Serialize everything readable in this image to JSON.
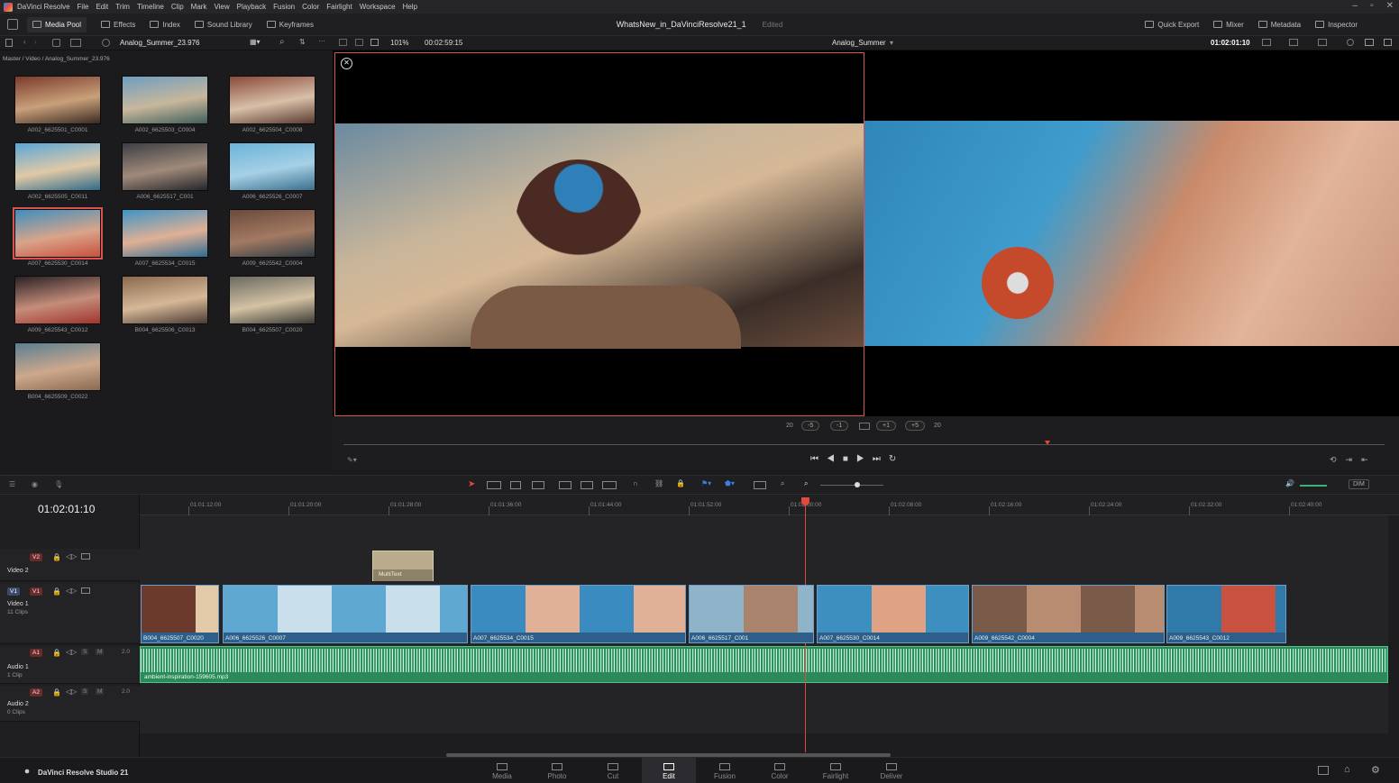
{
  "app": {
    "name": "DaVinci Resolve",
    "studio_label": "DaVinci Resolve Studio 21"
  },
  "menu": [
    "File",
    "Edit",
    "Trim",
    "Timeline",
    "Clip",
    "Mark",
    "View",
    "Playback",
    "Fusion",
    "Color",
    "Fairlight",
    "Workspace",
    "Help"
  ],
  "toolbar": {
    "left": [
      "Media Pool",
      "Effects",
      "Index",
      "Sound Library",
      "Keyframes"
    ],
    "project_title": "WhatsNew_in_DaVinciResolve21_1",
    "edited": "Edited",
    "right": [
      "Quick Export",
      "Mixer",
      "Metadata",
      "Inspector"
    ]
  },
  "subbar": {
    "bin": "Analog_Summer_23.976",
    "zoom": "101%",
    "duration": "00:02:59:15",
    "timeline_name": "Analog_Summer",
    "timecode": "01:02:01:10"
  },
  "mediapool": {
    "path": "Master / Video / Analog_Summer_23.976",
    "clips": [
      {
        "name": "A002_6625501_C0001",
        "colors": [
          "#7a3b2c",
          "#c9a07a",
          "#3a2a22"
        ]
      },
      {
        "name": "A002_6625503_C0004",
        "colors": [
          "#6f9ec0",
          "#c8b79c",
          "#3f5f5a"
        ]
      },
      {
        "name": "A002_6625504_C0008",
        "colors": [
          "#8a4a3a",
          "#d8c0a8",
          "#5a3a30"
        ]
      },
      {
        "name": "A002_6625505_C0011",
        "colors": [
          "#5aa7d8",
          "#e0c9a6",
          "#2f6a8a"
        ]
      },
      {
        "name": "A006_6625517_C001",
        "colors": [
          "#3c3f46",
          "#a08a7a",
          "#24262a"
        ]
      },
      {
        "name": "A006_6625526_C0007",
        "colors": [
          "#6bb3d8",
          "#a6d0e6",
          "#3b6f8c"
        ]
      },
      {
        "name": "A007_6625530_C0014",
        "colors": [
          "#3d8fc0",
          "#d9a48a",
          "#c9503c"
        ]
      },
      {
        "name": "A007_6625534_C0015",
        "colors": [
          "#3e94c6",
          "#e0b095",
          "#2f6c92"
        ]
      },
      {
        "name": "A009_6625542_C0004",
        "colors": [
          "#6a4a3c",
          "#a37a62",
          "#2e3b44"
        ]
      },
      {
        "name": "A009_6625543_C0012",
        "colors": [
          "#2a2224",
          "#c58d7a",
          "#a0342c"
        ]
      },
      {
        "name": "B004_6625506_C0013",
        "colors": [
          "#8a6a4e",
          "#d6b898",
          "#4a3a32"
        ]
      },
      {
        "name": "B004_6625507_C0020",
        "colors": [
          "#6b6a62",
          "#d4c2a4",
          "#3a3a34"
        ]
      },
      {
        "name": "B004_6625509_C0022",
        "colors": [
          "#5a7f92",
          "#cda88c",
          "#8a6a52"
        ]
      }
    ]
  },
  "viewer": {
    "transport_offsets": [
      "20",
      "-5",
      "-1",
      "+1",
      "+5",
      "20"
    ]
  },
  "timeline": {
    "timecode": "01:02:01:10",
    "ruler": [
      "01:01:12:00",
      "01:01:20:00",
      "01:01:28:00",
      "01:01:36:00",
      "01:01:44:00",
      "01:01:52:00",
      "01:02:00:00",
      "01:02:08:00",
      "01:02:16:00",
      "01:02:24:00",
      "01:02:32:00",
      "01:02:40:00"
    ],
    "tracks": {
      "v2": {
        "badge": "V2",
        "name": "Video 2"
      },
      "v1": {
        "badge_a": "V1",
        "badge": "V1",
        "name": "Video 1",
        "count": "11 Clips"
      },
      "a1": {
        "badge": "A1",
        "name": "Audio 1",
        "count": "1 Clip",
        "level": "2.0"
      },
      "a2": {
        "badge": "A2",
        "name": "Audio 2",
        "count": "0 Clips",
        "level": "2.0"
      }
    },
    "multitext": "MultiText",
    "clips": [
      {
        "name": "B004_6625507_C0020",
        "colors": [
          "#6b3a2c",
          "#e2c9a8"
        ]
      },
      {
        "name": "A006_6625526_C0007",
        "colors": [
          "#5fa8d2",
          "#c9e0ec"
        ]
      },
      {
        "name": "A007_6625534_C0015",
        "colors": [
          "#3a8cc0",
          "#e0b197"
        ]
      },
      {
        "name": "A006_6625517_C001",
        "colors": [
          "#8fb3c8",
          "#a9836c"
        ]
      },
      {
        "name": "A007_6625530_C0014",
        "colors": [
          "#3d8fc0",
          "#dfa285"
        ]
      },
      {
        "name": "A009_6625542_C0004",
        "colors": [
          "#7a5a48",
          "#b78c70"
        ]
      },
      {
        "name": "A009_6625543_C0012",
        "colors": [
          "#2f7aa8",
          "#c9513f"
        ]
      }
    ],
    "audio_clip": "ambient-inspiration-159605.mp3",
    "dim_label": "DIM",
    "track_buttons": {
      "s": "S",
      "m": "M"
    }
  },
  "pages": [
    "Media",
    "Photo",
    "Cut",
    "Edit",
    "Fusion",
    "Color",
    "Fairlight",
    "Deliver"
  ],
  "active_page": "Edit"
}
